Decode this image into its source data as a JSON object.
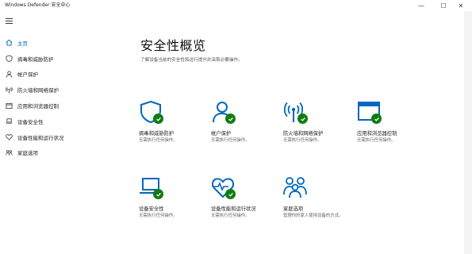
{
  "window": {
    "title": "Windows Defender 安全中心",
    "controls": {
      "minimize": "—",
      "maximize": "☐",
      "close": "✕"
    }
  },
  "sidebar": {
    "items": [
      {
        "label": "主页",
        "icon": "home-icon",
        "active": true
      },
      {
        "label": "病毒和威胁防护",
        "icon": "shield-icon",
        "active": false
      },
      {
        "label": "帐户保护",
        "icon": "person-icon",
        "active": false
      },
      {
        "label": "防火墙和网络保护",
        "icon": "antenna-icon",
        "active": false
      },
      {
        "label": "应用和浏览器控制",
        "icon": "app-window-icon",
        "active": false
      },
      {
        "label": "设备安全性",
        "icon": "laptop-icon",
        "active": false
      },
      {
        "label": "设备性能和运行状况",
        "icon": "heart-icon",
        "active": false
      },
      {
        "label": "家庭选项",
        "icon": "family-icon",
        "active": false
      }
    ]
  },
  "main": {
    "title": "安全性概览",
    "subtitle": "了解设备当前的安全性和运行提升并采取必要操作。",
    "tiles": [
      {
        "name": "病毒和威胁防护",
        "status": "无需执行任何操作。",
        "icon": "shield-icon",
        "ok": true
      },
      {
        "name": "帐户保护",
        "status": "无需执行任何操作。",
        "icon": "person-icon",
        "ok": true
      },
      {
        "name": "防火墙和网络保护",
        "status": "无需执行任何操作。",
        "icon": "antenna-icon",
        "ok": true
      },
      {
        "name": "应用和浏览器控制",
        "status": "无需执行任何操作。",
        "icon": "app-window-icon",
        "ok": true
      },
      {
        "name": "设备安全性",
        "status": "无需执行任何操作。",
        "icon": "laptop-icon",
        "ok": true
      },
      {
        "name": "设备性能和运行状况",
        "status": "无需执行任何操作。",
        "icon": "heart-icon",
        "ok": true
      },
      {
        "name": "家庭选项",
        "status": "管理你的家人使用设备的方式。",
        "icon": "family-icon",
        "ok": false
      }
    ]
  },
  "colors": {
    "accent": "#0067c0",
    "ok": "#107c10",
    "text": "#222222",
    "subtext": "#666666"
  }
}
